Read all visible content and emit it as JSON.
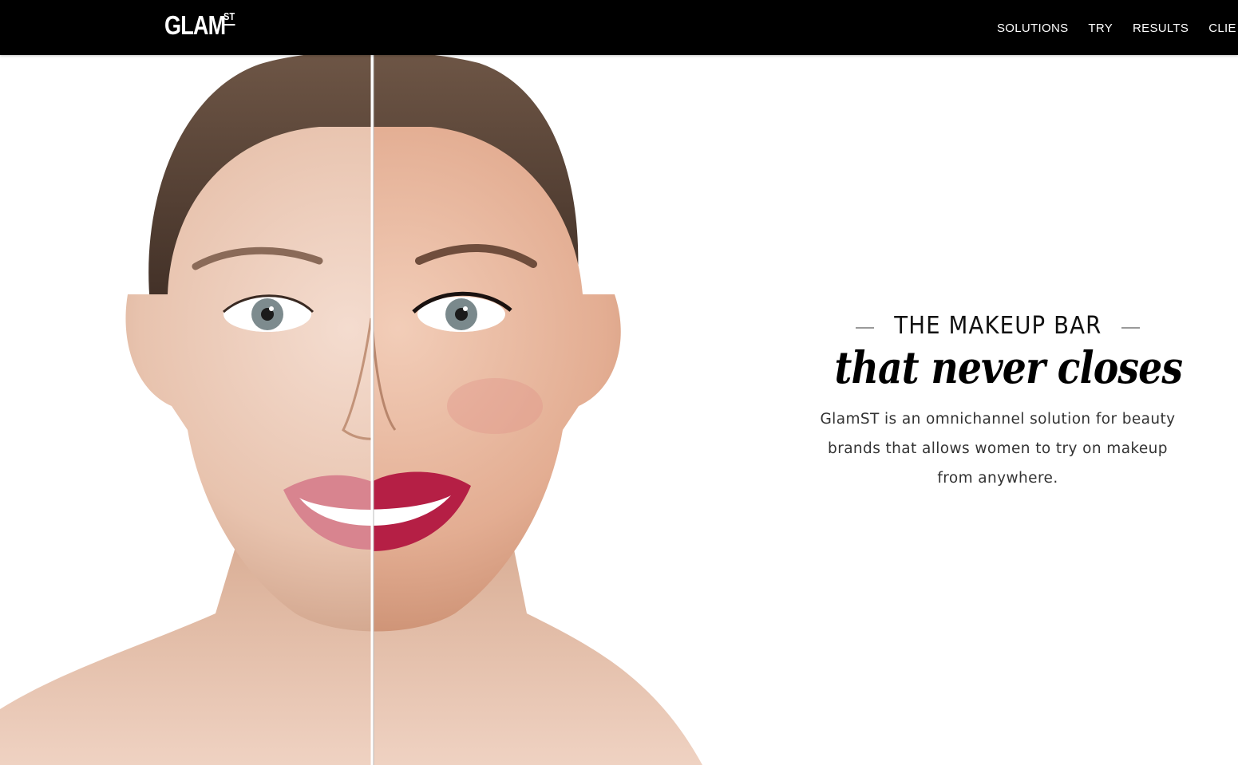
{
  "brand": {
    "logo_main": "GLAM",
    "logo_sup": "ST"
  },
  "nav": {
    "items": [
      "SOLUTIONS",
      "TRY",
      "RESULTS",
      "CLIE"
    ]
  },
  "hero": {
    "eyebrow": "THE MAKEUP BAR",
    "tagline": "that never closes",
    "description": "GlamST is an omnichannel solution for beauty brands that allows women to try on makeup from anywhere."
  },
  "colors": {
    "nav_bg": "#000000",
    "nav_text": "#ffffff",
    "page_bg": "#ffffff",
    "heading_text": "#111111",
    "body_text": "#333333",
    "lip_no_makeup": "#d8848f",
    "lip_makeup": "#b51f45"
  },
  "images": {
    "hero_photo": "before-after-makeup-face-photo",
    "divider": "before-after-split-line"
  }
}
